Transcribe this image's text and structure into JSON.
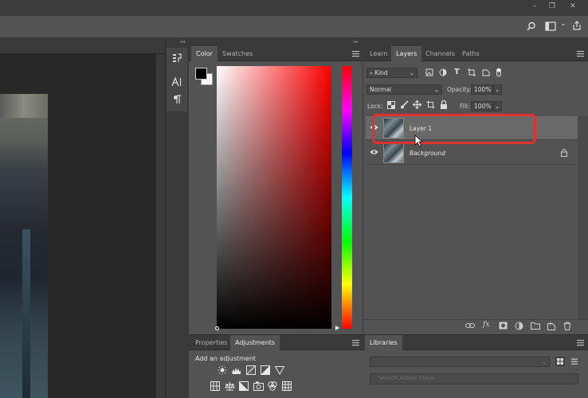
{
  "window": {
    "minimize": "–",
    "restore": "❐",
    "close": "✕"
  },
  "optionsbar": {
    "search_icon": "search-icon",
    "workspace_icon": "workspace-icon",
    "chevron": "⌄",
    "share_icon": "share-icon"
  },
  "tools_panel": {
    "collapse_glyph": "◂◂",
    "expand_glyph": "▸▸"
  },
  "color_panel": {
    "tabs": [
      "Color",
      "Swatches"
    ],
    "foreground": "#000000",
    "background": "#ffffff"
  },
  "layers_panel": {
    "tabs": [
      "Learn",
      "Layers",
      "Channels",
      "Paths"
    ],
    "filter_kind": "Kind",
    "blend_mode": "Normal",
    "opacity_label": "Opacity:",
    "opacity_value": "100%",
    "lock_label": "Lock:",
    "fill_label": "Fill:",
    "fill_value": "100%",
    "layers": [
      {
        "name": "Layer 1",
        "selected": true,
        "visible": true,
        "locked": false
      },
      {
        "name": "Background",
        "selected": false,
        "visible": true,
        "locked": true
      }
    ],
    "highlight_color": "#e2302f"
  },
  "properties_panel": {
    "tabs": [
      "Properties",
      "Adjustments"
    ],
    "heading": "Add an adjustment"
  },
  "libraries_panel": {
    "tabs": [
      "Libraries"
    ],
    "search_placeholder": "Search Adobe Stock"
  }
}
